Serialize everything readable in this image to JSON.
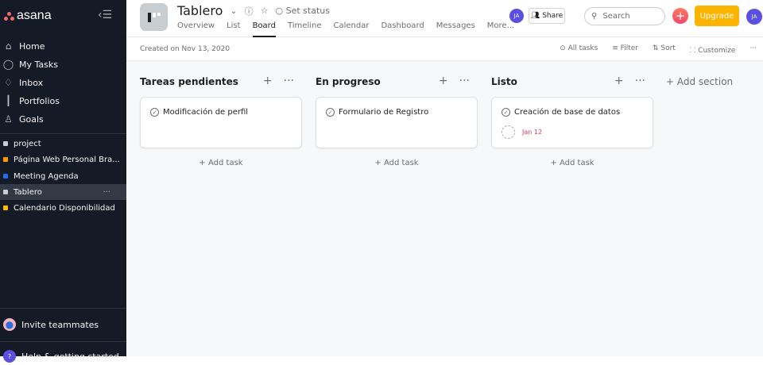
{
  "sidebar": {
    "logo": "asana",
    "nav": [
      {
        "label": "Home",
        "icon": "home-icon"
      },
      {
        "label": "My Tasks",
        "icon": "check-circle-icon"
      },
      {
        "label": "Inbox",
        "icon": "bell-icon"
      },
      {
        "label": "Portfolios",
        "icon": "bar-chart-icon"
      },
      {
        "label": "Goals",
        "icon": "person-icon"
      }
    ],
    "projects": [
      {
        "label": "project",
        "color": "#c8cdd2"
      },
      {
        "label": "Página Web Personal Bra...",
        "color": "#fd9a00"
      },
      {
        "label": "Meeting Agenda",
        "color": "#4573d2"
      },
      {
        "label": "Tablero",
        "color": "#c8cdd2",
        "active": true
      },
      {
        "label": "Calendario Disponibilidad",
        "color": "#fcbd01"
      }
    ],
    "invite": "Invite teammates",
    "help": "Help & getting started"
  },
  "header": {
    "title": "Tablero",
    "set_status": "Set status",
    "tabs": [
      "Overview",
      "List",
      "Board",
      "Timeline",
      "Calendar",
      "Dashboard",
      "Messages",
      "More..."
    ],
    "active_tab": "Board",
    "avatar": "JA",
    "share": "Share",
    "search_placeholder": "Search",
    "upgrade": "Upgrade",
    "user_avatar": "JA"
  },
  "toolbar": {
    "created": "Created on Nov 13, 2020",
    "all_tasks": "All tasks",
    "filter": "Filter",
    "sort": "Sort",
    "customize": "Customize"
  },
  "board": {
    "add_section": "+ Add section",
    "add_task": "+ Add task",
    "columns": [
      {
        "title": "Tareas pendientes",
        "cards": [
          {
            "title": "Modificación de perfil"
          }
        ]
      },
      {
        "title": "En progreso",
        "cards": [
          {
            "title": "Formulario de Registro"
          }
        ]
      },
      {
        "title": "Listo",
        "cards": [
          {
            "title": "Creación de base de datos",
            "due": "Jan 12"
          }
        ]
      }
    ]
  },
  "colors": {
    "sidebar": "#151b26",
    "upgrade": "#fcb400",
    "due": "#e8384f"
  }
}
